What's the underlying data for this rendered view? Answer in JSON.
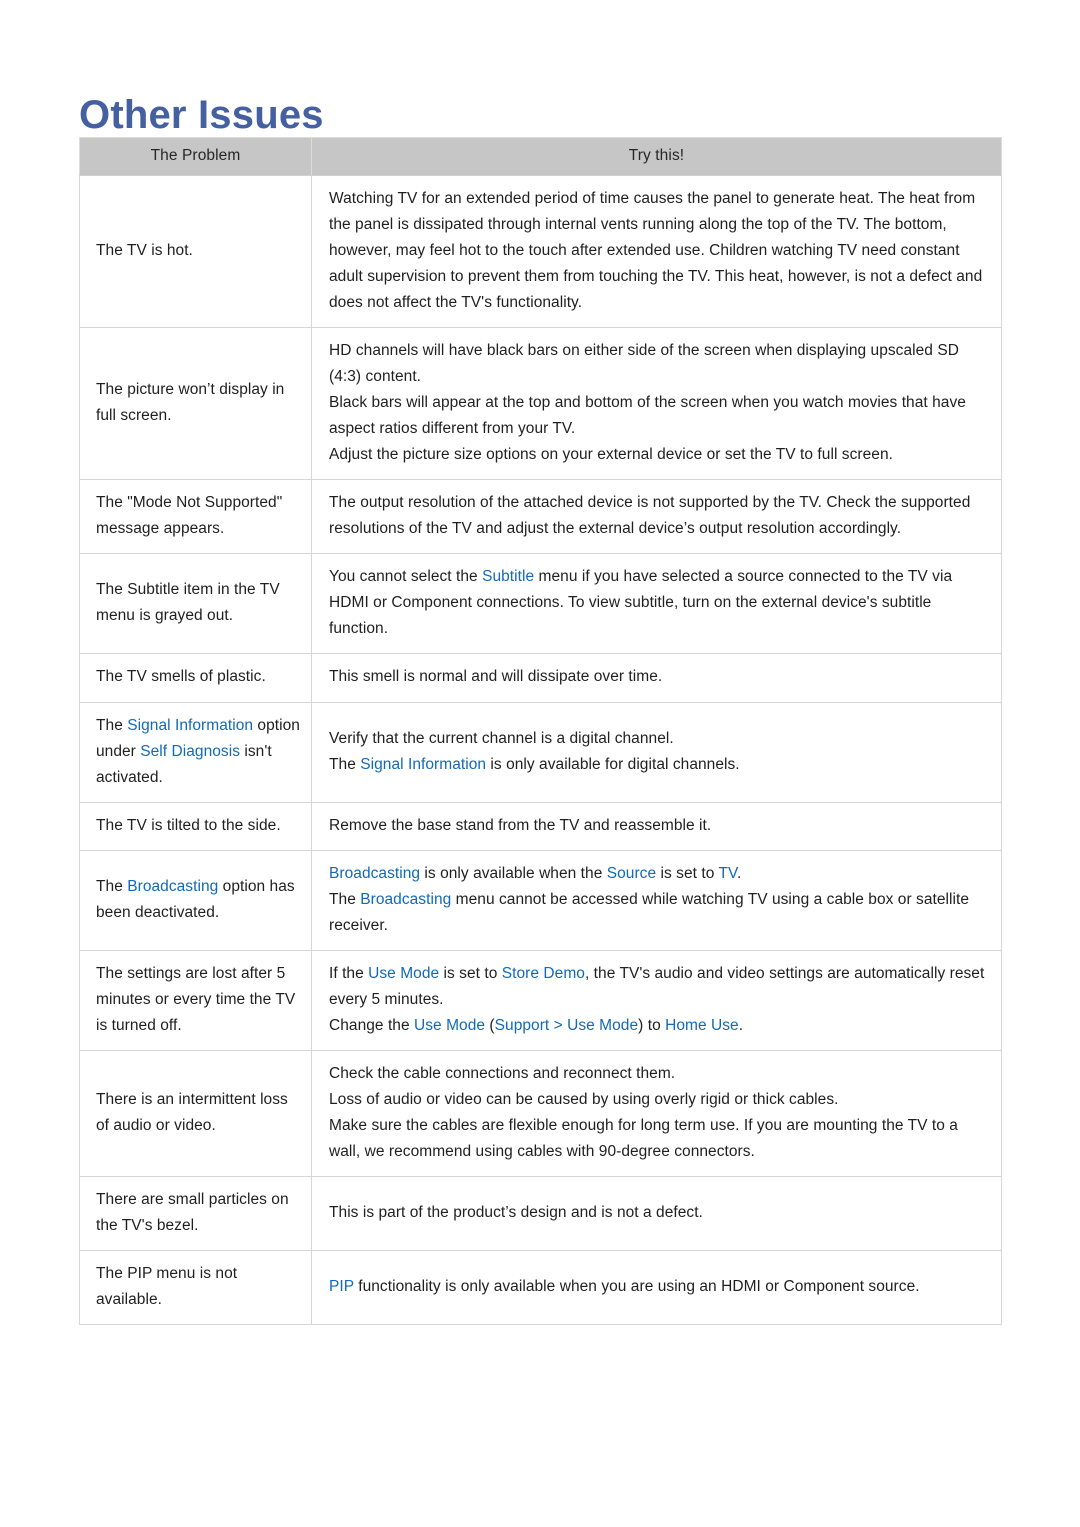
{
  "document": {
    "title": "Other Issues"
  },
  "table": {
    "headers": {
      "problem": "The Problem",
      "try_this": "Try this!"
    },
    "rows": [
      {
        "problem": "The TV is hot.",
        "solution_lines": [
          "Watching TV for an extended period of time causes the panel to generate heat. The heat from the panel is dissipated through internal vents running along the top of the TV. The bottom, however, may feel hot to the touch after extended use. Children watching TV need constant adult supervision to prevent them from touching the TV. This heat, however, is not a defect and does not affect the TV's functionality."
        ]
      },
      {
        "problem": "The picture won’t display in full screen.",
        "solution_lines": [
          "HD channels will have black bars on either side of the screen when displaying upscaled SD (4:3) content.",
          "Black bars will appear at the top and bottom of the screen when you watch movies that have aspect ratios different from your TV.",
          "Adjust the picture size options on your external device or set the TV to full screen."
        ]
      },
      {
        "problem": "The \"Mode Not Supported\" message appears.",
        "solution_lines": [
          "The output resolution of the attached device is not supported by the TV. Check the supported resolutions of the TV and adjust the external device’s output resolution accordingly."
        ]
      },
      {
        "problem": "The Subtitle item in the TV menu is grayed out.",
        "solution_parts": [
          {
            "t": "You cannot select the ",
            "hl": false
          },
          {
            "t": "Subtitle",
            "hl": true
          },
          {
            "t": " menu if you have selected a source connected to the TV via HDMI or Component connections. To view subtitle, turn on the external device's subtitle function.",
            "hl": false
          }
        ]
      },
      {
        "problem": "The TV smells of plastic.",
        "solution_lines": [
          "This smell is normal and will dissipate over time."
        ]
      },
      {
        "problem_parts": [
          {
            "t": "The ",
            "hl": false
          },
          {
            "t": "Signal Information",
            "hl": true
          },
          {
            "t": " option under ",
            "hl": false
          },
          {
            "t": "Self Diagnosis",
            "hl": true
          },
          {
            "t": " isn't activated.",
            "hl": false
          }
        ],
        "solution_line_parts": [
          [
            {
              "t": "Verify that the current channel is a digital channel.",
              "hl": false
            }
          ],
          [
            {
              "t": "The ",
              "hl": false
            },
            {
              "t": "Signal Information",
              "hl": true
            },
            {
              "t": " is only available for digital channels.",
              "hl": false
            }
          ]
        ]
      },
      {
        "problem": "The TV is tilted to the side.",
        "solution_lines": [
          "Remove the base stand from the TV and reassemble it."
        ]
      },
      {
        "problem_parts": [
          {
            "t": "The ",
            "hl": false
          },
          {
            "t": "Broadcasting",
            "hl": true
          },
          {
            "t": " option has been deactivated.",
            "hl": false
          }
        ],
        "solution_line_parts": [
          [
            {
              "t": "Broadcasting",
              "hl": true
            },
            {
              "t": " is only available when the ",
              "hl": false
            },
            {
              "t": "Source",
              "hl": true
            },
            {
              "t": " is set to ",
              "hl": false
            },
            {
              "t": "TV",
              "hl": true
            },
            {
              "t": ".",
              "hl": false
            }
          ],
          [
            {
              "t": "The ",
              "hl": false
            },
            {
              "t": "Broadcasting",
              "hl": true
            },
            {
              "t": " menu cannot be accessed while watching TV using a cable box or satellite receiver.",
              "hl": false
            }
          ]
        ]
      },
      {
        "problem": "The settings are lost after 5 minutes or every time the TV is turned off.",
        "solution_line_parts": [
          [
            {
              "t": "If the ",
              "hl": false
            },
            {
              "t": "Use Mode",
              "hl": true
            },
            {
              "t": " is set to ",
              "hl": false
            },
            {
              "t": "Store Demo",
              "hl": true
            },
            {
              "t": ", the TV's audio and video settings are automatically reset every 5 minutes.",
              "hl": false
            }
          ],
          [
            {
              "t": "Change the ",
              "hl": false
            },
            {
              "t": "Use Mode",
              "hl": true
            },
            {
              "t": " (",
              "hl": false
            },
            {
              "t": "Support",
              "hl": true
            },
            {
              "t": " > ",
              "hl": true
            },
            {
              "t": "Use Mode",
              "hl": true
            },
            {
              "t": ") to ",
              "hl": false
            },
            {
              "t": "Home Use",
              "hl": true
            },
            {
              "t": ".",
              "hl": false
            }
          ]
        ]
      },
      {
        "problem": "There is an intermittent loss of audio or video.",
        "solution_lines": [
          "Check the cable connections and reconnect them.",
          "Loss of audio or video can be caused by using overly rigid or thick cables.",
          "Make sure the cables are flexible enough for long term use. If you are mounting the TV to a wall, we recommend using cables with 90-degree connectors."
        ]
      },
      {
        "problem": "There are small particles on the TV's bezel.",
        "solution_lines": [
          "This is part of the product’s design and is not a defect."
        ]
      },
      {
        "problem": "The PIP menu is not available.",
        "solution_parts": [
          {
            "t": "PIP",
            "hl": true
          },
          {
            "t": " functionality is only available when you are using an HDMI or Component source.",
            "hl": false
          }
        ]
      }
    ]
  },
  "colors": {
    "title": "#4560a0",
    "highlight": "#1269b8",
    "header_bg": "#c6c6c6",
    "border": "#d6d6d6",
    "text": "#1f1f1f"
  }
}
